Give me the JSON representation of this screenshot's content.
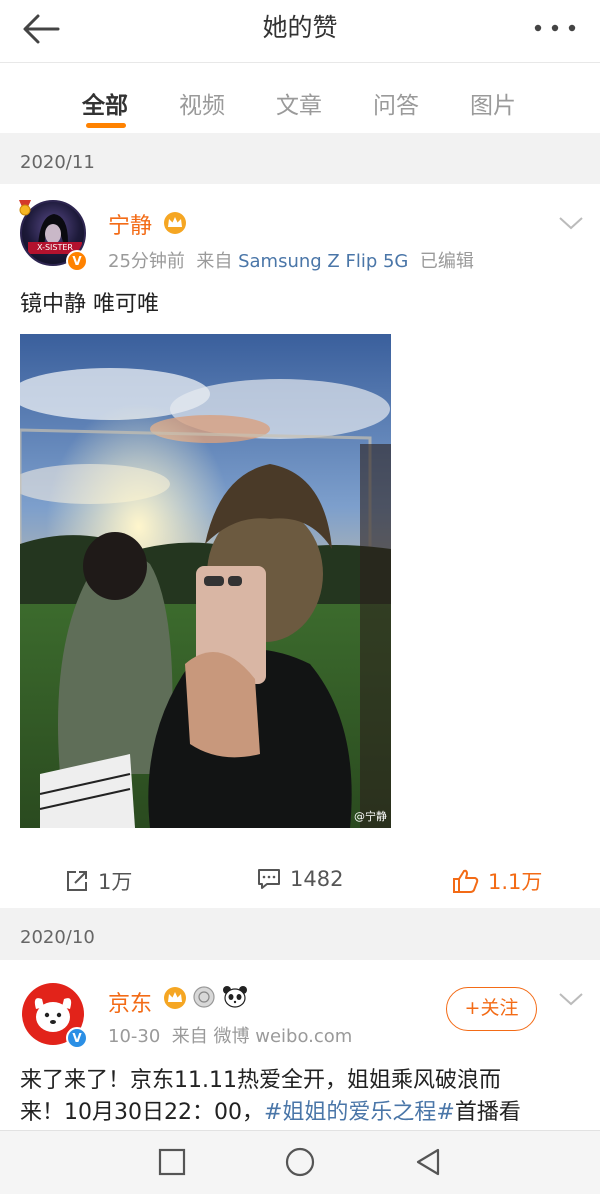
{
  "header": {
    "title": "她的赞",
    "back_icon": "back-arrow-icon",
    "more_icon": "more-dots-icon"
  },
  "tabs": [
    {
      "label": "全部",
      "active": true
    },
    {
      "label": "视频",
      "active": false
    },
    {
      "label": "文章",
      "active": false
    },
    {
      "label": "问答",
      "active": false
    },
    {
      "label": "图片",
      "active": false
    }
  ],
  "groups": [
    {
      "date": "2020/11",
      "post": {
        "avatar_text": "X-SISTER",
        "username": "宁静",
        "time": "25分钟前",
        "source_prefix": "来自",
        "source": "Samsung Z Flip 5G",
        "edited": "已编辑",
        "text": "镜中静  唯可唯",
        "image_watermark": "@宁静",
        "actions": {
          "share": "1万",
          "comment": "1482",
          "like": "1.1万"
        }
      }
    },
    {
      "date": "2020/10",
      "post": {
        "username": "京东",
        "time": "10-30",
        "source_prefix": "来自",
        "source": "微博 weibo.com",
        "follow_label": "+关注",
        "text_line1": "来了来了！京东11.11热爱全开，姐姐乘风破浪而",
        "text_line2_prefix": "来！10月30日22：00，",
        "text_topic": "#姐姐的爱乐之程#",
        "text_line2_suffix": "首播看"
      }
    }
  ],
  "colors": {
    "accent": "#ff8200",
    "username": "#f36b16",
    "link": "#4a76a8"
  },
  "navbar": {
    "recent_icon": "square-icon",
    "home_icon": "circle-icon",
    "back_icon": "triangle-back-icon"
  }
}
